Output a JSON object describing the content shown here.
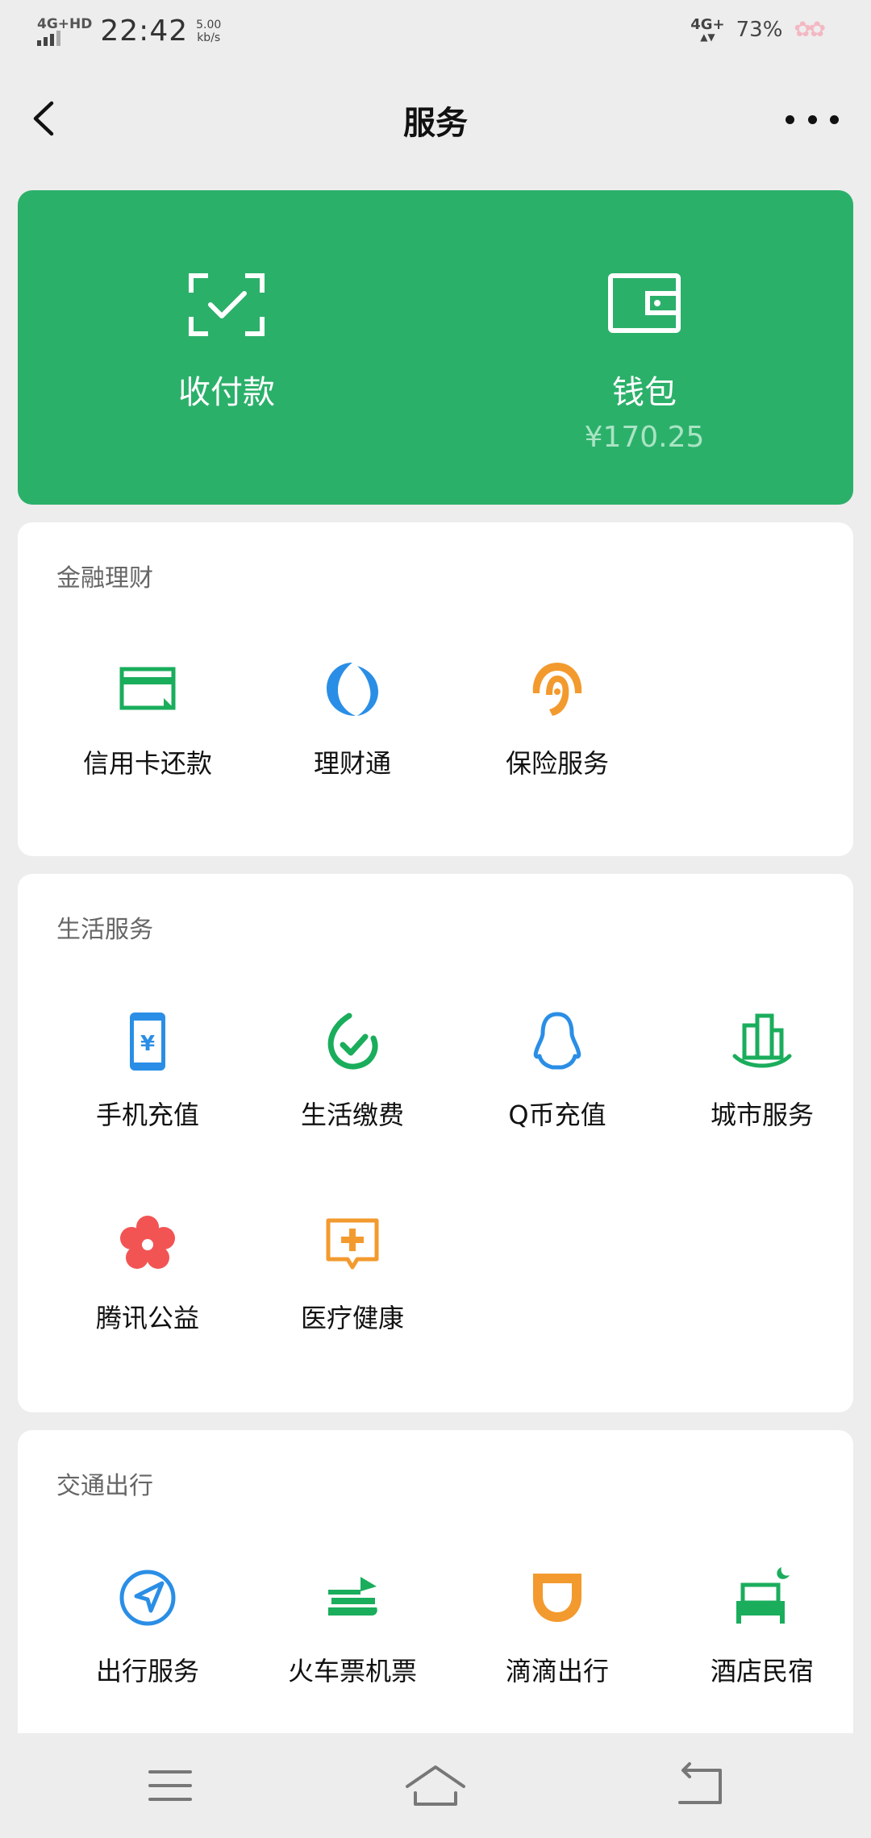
{
  "status_bar": {
    "network_left": "4G+HD",
    "time": "22:42",
    "speed_value": "5.00",
    "speed_unit": "kb/s",
    "network_right": "4G+",
    "battery": "73%"
  },
  "nav": {
    "title": "服务",
    "back_icon": "chevron-left-icon",
    "more_icon": "more-dots-icon"
  },
  "top_card": {
    "pay": {
      "label": "收付款",
      "icon": "scan-check-icon"
    },
    "wallet": {
      "label": "钱包",
      "balance": "¥170.25",
      "icon": "wallet-icon"
    },
    "colors": {
      "background": "#2bb06a"
    }
  },
  "sections": {
    "finance": {
      "title": "金融理财",
      "items": [
        {
          "label": "信用卡还款",
          "icon": "credit-card-icon"
        },
        {
          "label": "理财通",
          "icon": "wealth-icon"
        },
        {
          "label": "保险服务",
          "icon": "insurance-umbrella-icon"
        }
      ]
    },
    "life": {
      "title": "生活服务",
      "items": [
        {
          "label": "手机充值",
          "icon": "phone-recharge-icon"
        },
        {
          "label": "生活缴费",
          "icon": "utility-bill-icon"
        },
        {
          "label": "Q币充值",
          "icon": "qq-penguin-icon"
        },
        {
          "label": "城市服务",
          "icon": "city-buildings-icon"
        },
        {
          "label": "腾讯公益",
          "icon": "charity-flower-icon"
        },
        {
          "label": "医疗健康",
          "icon": "medical-cross-icon"
        }
      ]
    },
    "travel": {
      "title": "交通出行",
      "items": [
        {
          "label": "出行服务",
          "icon": "navigation-arrow-icon"
        },
        {
          "label": "火车票机票",
          "icon": "train-plane-icon"
        },
        {
          "label": "滴滴出行",
          "icon": "didi-icon"
        },
        {
          "label": "酒店民宿",
          "icon": "hotel-bed-icon"
        }
      ]
    }
  },
  "bottom_nav": {
    "menu_icon": "menu-icon",
    "home_icon": "home-icon",
    "back_icon": "back-arrow-icon"
  }
}
